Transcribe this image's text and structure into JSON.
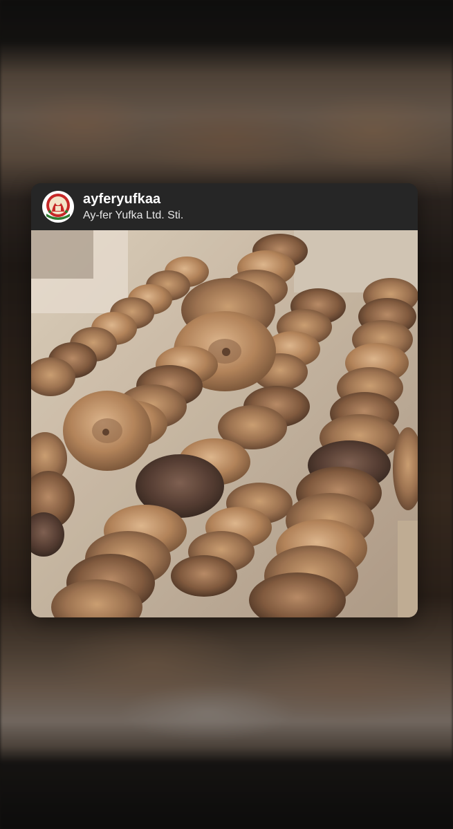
{
  "sticker": {
    "username": "ayferyufkaa",
    "display_name": "Ay-fer Yufka Ltd. Sti.",
    "avatar_logo_text": "AY-FER YUFKA",
    "photo_subject": "dried figs"
  },
  "colors": {
    "card_header_bg": "#262626",
    "username_color": "#ffffff",
    "logo_red": "#c62828",
    "logo_green": "#2e7d32"
  },
  "icons": {
    "avatar": "bakery-logo-icon"
  }
}
